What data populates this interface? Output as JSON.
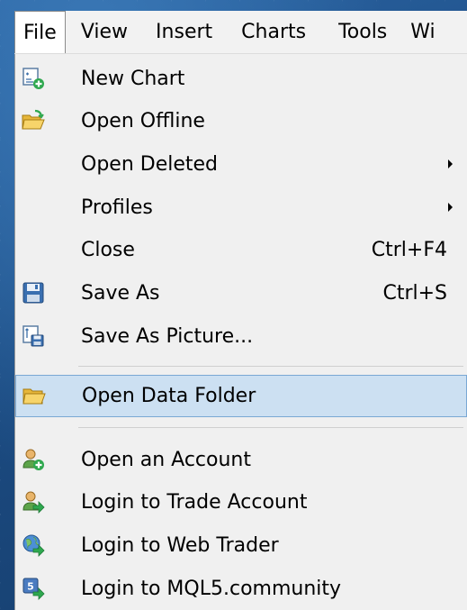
{
  "menubar": {
    "items": [
      {
        "label": "File",
        "active": true
      },
      {
        "label": "View"
      },
      {
        "label": "Insert"
      },
      {
        "label": "Charts"
      },
      {
        "label": "Tools"
      },
      {
        "label": "Wi"
      }
    ]
  },
  "file_menu": {
    "items": [
      {
        "label": "New Chart",
        "icon": "new-chart-icon"
      },
      {
        "label": "Open Offline",
        "icon": "open-folder-icon"
      },
      {
        "label": "Open Deleted",
        "submenu": true
      },
      {
        "label": "Profiles",
        "submenu": true
      },
      {
        "label": "Close",
        "shortcut": "Ctrl+F4"
      },
      {
        "label": "Save As",
        "shortcut": "Ctrl+S",
        "icon": "floppy-disk-icon"
      },
      {
        "label": "Save As Picture...",
        "icon": "save-picture-icon"
      },
      {
        "label": "Open Data Folder",
        "icon": "folder-icon",
        "highlighted": true
      },
      {
        "label": "Open an Account",
        "icon": "user-add-icon"
      },
      {
        "label": "Login to Trade Account",
        "icon": "user-login-icon"
      },
      {
        "label": "Login to Web Trader",
        "icon": "globe-login-icon"
      },
      {
        "label": "Login to MQL5.community",
        "icon": "mql5-login-icon"
      }
    ]
  },
  "colors": {
    "highlight_bg": "#cce0f2",
    "highlight_border": "#7aa8d4",
    "menu_bg": "#f0f0f0",
    "desktop_bg": "#1d4f86"
  }
}
